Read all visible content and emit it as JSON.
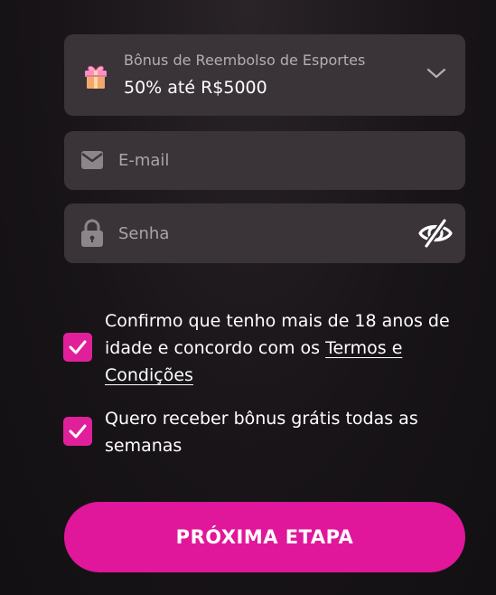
{
  "bonus_select": {
    "title": "Bônus de Reembolso de Esportes",
    "value": "50% até R$5000",
    "icon": "gift-icon",
    "chevron_icon": "chevron-down-icon"
  },
  "email": {
    "placeholder": "E-mail",
    "value": "",
    "icon": "envelope-icon"
  },
  "password": {
    "placeholder": "Senha",
    "value": "",
    "icon": "lock-icon",
    "toggle_icon": "eye-off-icon"
  },
  "terms": {
    "checked": true,
    "text_before": "Confirmo que tenho mais de 18 anos de idade e concordo com os ",
    "link_text": "Termos e Condições"
  },
  "weekly_bonus": {
    "checked": true,
    "text": "Quero receber bônus grátis todas as semanas"
  },
  "submit_button": {
    "label": "PRÓXIMA ETAPA"
  },
  "colors": {
    "accent": "#e0179a",
    "field_bg": "#3a3439",
    "page_bg": "#181418",
    "muted_text": "#aaa3a8"
  }
}
